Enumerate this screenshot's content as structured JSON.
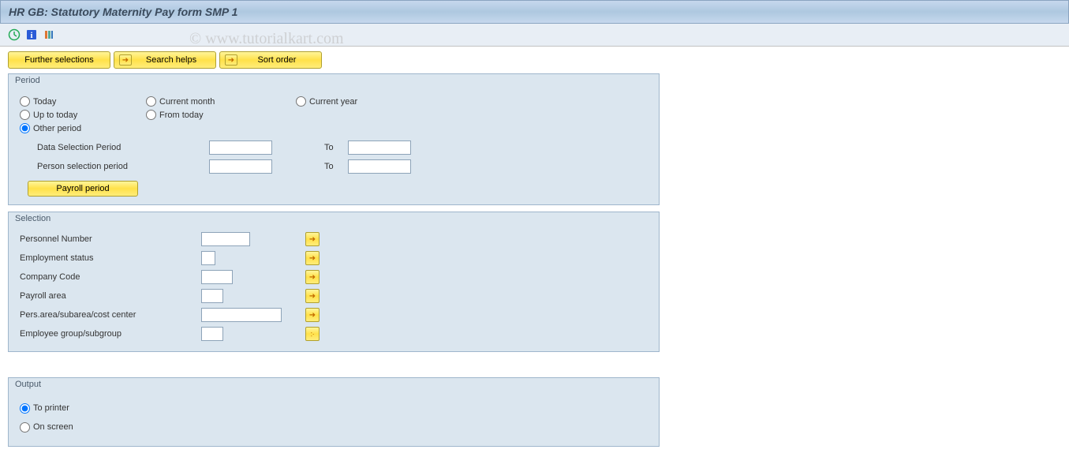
{
  "title": "HR GB: Statutory Maternity Pay form SMP 1",
  "watermark": "© www.tutorialkart.com",
  "toolbar_buttons": {
    "further_selections": "Further selections",
    "search_helps": "Search helps",
    "sort_order": "Sort order"
  },
  "period": {
    "group_label": "Period",
    "radios": {
      "today": "Today",
      "current_month": "Current month",
      "current_year": "Current year",
      "up_to_today": "Up to today",
      "from_today": "From today",
      "other_period": "Other period"
    },
    "data_selection_label": "Data Selection Period",
    "person_selection_label": "Person selection period",
    "to_label": "To",
    "payroll_period_btn": "Payroll period",
    "data_from": "",
    "data_to": "",
    "person_from": "",
    "person_to": ""
  },
  "selection": {
    "group_label": "Selection",
    "rows": {
      "personnel_number": "Personnel Number",
      "employment_status": "Employment status",
      "company_code": "Company Code",
      "payroll_area": "Payroll area",
      "pers_area": "Pers.area/subarea/cost center",
      "employee_group": "Employee group/subgroup"
    },
    "values": {
      "personnel_number": "",
      "employment_status": "",
      "company_code": "",
      "payroll_area": "",
      "pers_area": "",
      "employee_group": ""
    }
  },
  "output": {
    "group_label": "Output",
    "to_printer": "To printer",
    "on_screen": "On screen"
  }
}
